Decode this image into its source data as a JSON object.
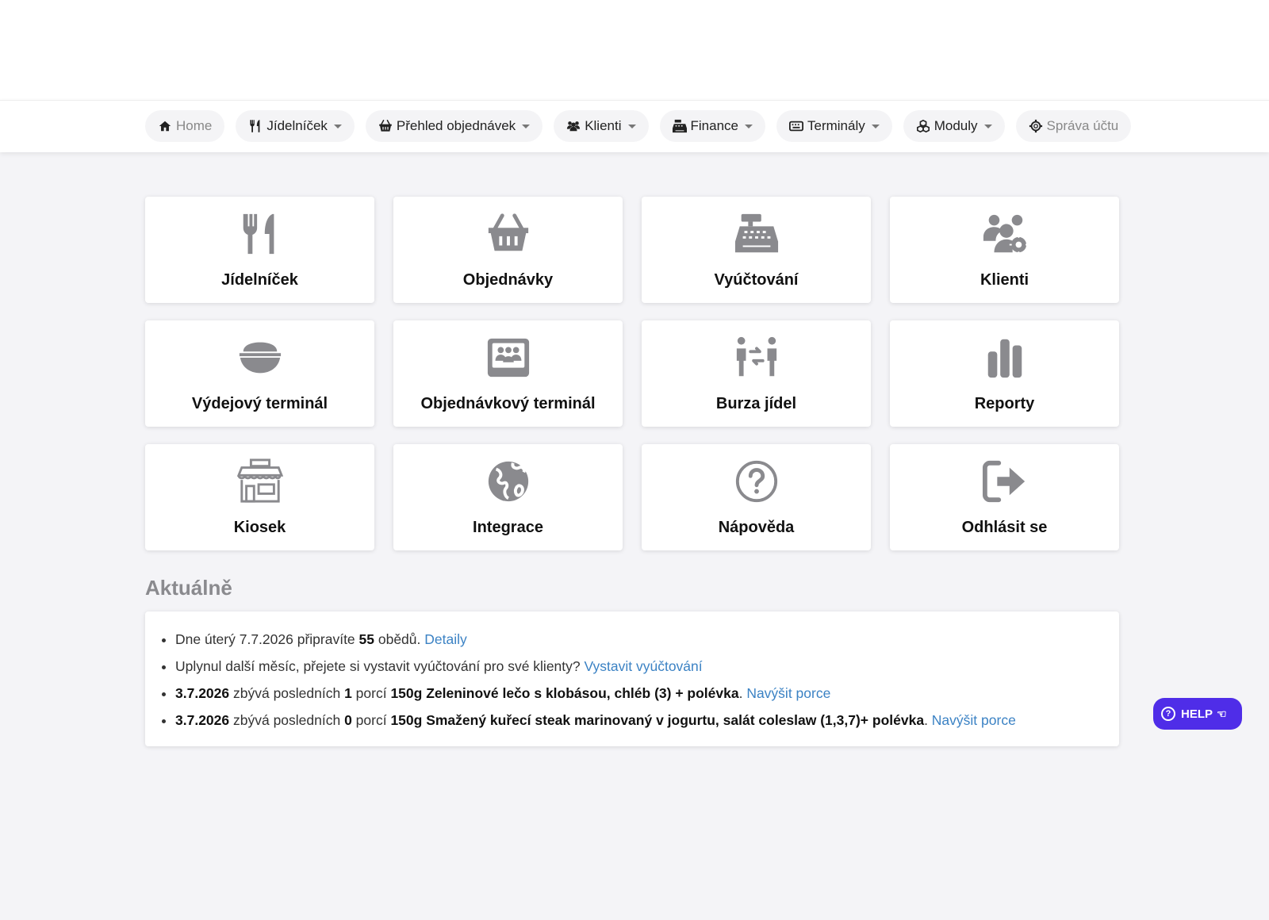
{
  "nav": {
    "items": [
      {
        "label": "Home",
        "icon": "home-icon",
        "dropdown": false,
        "muted": true
      },
      {
        "label": "Jídelníček",
        "icon": "utensils-icon",
        "dropdown": true,
        "muted": false
      },
      {
        "label": "Přehled objednávek",
        "icon": "basket-icon",
        "dropdown": true,
        "muted": false
      },
      {
        "label": "Klienti",
        "icon": "users-icon",
        "dropdown": true,
        "muted": false
      },
      {
        "label": "Finance",
        "icon": "cash-register-icon",
        "dropdown": true,
        "muted": false
      },
      {
        "label": "Terminály",
        "icon": "keyboard-icon",
        "dropdown": true,
        "muted": false
      },
      {
        "label": "Moduly",
        "icon": "cubes-icon",
        "dropdown": true,
        "muted": false
      },
      {
        "label": "Správa účtu",
        "icon": "gear-icon",
        "dropdown": false,
        "muted": true
      }
    ]
  },
  "tiles": [
    {
      "label": "Jídelníček",
      "icon": "utensils-icon"
    },
    {
      "label": "Objednávky",
      "icon": "basket-icon"
    },
    {
      "label": "Vyúčtování",
      "icon": "cash-register-icon"
    },
    {
      "label": "Klienti",
      "icon": "users-gear-icon"
    },
    {
      "label": "Výdejový terminál",
      "icon": "bowl-icon"
    },
    {
      "label": "Objednávkový terminál",
      "icon": "screen-users-icon"
    },
    {
      "label": "Burza jídel",
      "icon": "exchange-people-icon"
    },
    {
      "label": "Reporty",
      "icon": "bar-chart-icon"
    },
    {
      "label": "Kiosek",
      "icon": "shop-icon"
    },
    {
      "label": "Integrace",
      "icon": "globe-icon"
    },
    {
      "label": "Nápověda",
      "icon": "question-icon"
    },
    {
      "label": "Odhlásit se",
      "icon": "logout-icon"
    }
  ],
  "news": {
    "title": "Aktuálně",
    "items": [
      {
        "parts": [
          {
            "t": "Dne úterý 7.7.2026 připravíte ",
            "s": "text"
          },
          {
            "t": "55",
            "s": "bold"
          },
          {
            "t": " obědů. ",
            "s": "text"
          },
          {
            "t": "Detaily",
            "s": "link"
          }
        ]
      },
      {
        "parts": [
          {
            "t": "Uplynul další měsíc, přejete si vystavit vyúčtování pro své klienty? ",
            "s": "text"
          },
          {
            "t": "Vystavit vyúčtování",
            "s": "link"
          }
        ]
      },
      {
        "parts": [
          {
            "t": "3.7.2026",
            "s": "bold"
          },
          {
            "t": " zbývá posledních ",
            "s": "text"
          },
          {
            "t": "1",
            "s": "bold"
          },
          {
            "t": " porcí ",
            "s": "text"
          },
          {
            "t": "150g Zeleninové lečo s klobásou, chléb (3) + polévka",
            "s": "bold"
          },
          {
            "t": ". ",
            "s": "text"
          },
          {
            "t": "Navýšit porce",
            "s": "link"
          }
        ]
      },
      {
        "parts": [
          {
            "t": "3.7.2026",
            "s": "bold"
          },
          {
            "t": " zbývá posledních ",
            "s": "text"
          },
          {
            "t": "0",
            "s": "bold"
          },
          {
            "t": " porcí ",
            "s": "text"
          },
          {
            "t": "150g Smažený kuřecí steak marinovaný v jogurtu, salát coleslaw (1,3,7)+ polévka",
            "s": "bold"
          },
          {
            "t": ". ",
            "s": "text"
          },
          {
            "t": "Navýšit porce",
            "s": "link"
          }
        ]
      }
    ]
  },
  "help": {
    "label": "HELP",
    "icon": "pointing-hand-icon"
  },
  "colors": {
    "accent": "#4f2de8",
    "link": "#3b82c4",
    "icon": "#8a8a8e"
  }
}
